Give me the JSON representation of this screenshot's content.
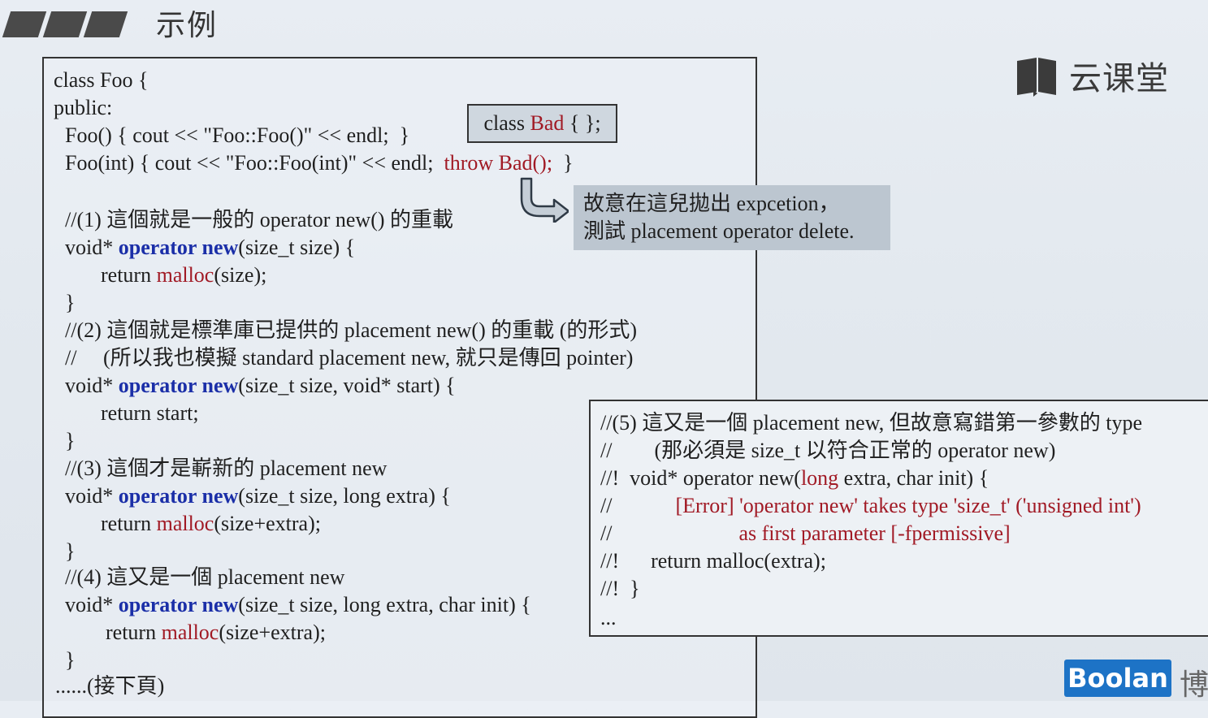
{
  "header": {
    "title": "示例"
  },
  "brand": {
    "name": "云课堂",
    "icon": "open-book-icon"
  },
  "code": {
    "l1": "class Foo {",
    "l2": "public:",
    "l3": "Foo() { cout << \"Foo::Foo()\" << endl;  }",
    "l4_pre": "Foo(int) { cout << \"Foo::Foo(int)\" << endl;  ",
    "l4_throw": "throw Bad();",
    "l4_post": "  }",
    "c1": "//(1) 這個就是一般的 operator new() 的重載",
    "op1_pre": "void* ",
    "op_kw": "operator new",
    "op1_post": "(size_t size) {",
    "ret1_pre": "return ",
    "malloc": "malloc",
    "ret1_post": "(size);",
    "close1": "}",
    "c2": "//(2) 這個就是標準庫已提供的 placement new() 的重載 (的形式)",
    "c2b": "//     (所以我也模擬 standard placement new, 就只是傳回 pointer)",
    "op2_pre": "void* ",
    "op2_post": "(size_t size, void* start) {",
    "ret2": "return start;",
    "close2": "}",
    "c3": "//(3) 這個才是嶄新的 placement new",
    "op3_pre": "void* ",
    "op3_post": "(size_t size, long extra) {",
    "ret3_pre": "return ",
    "ret3_post": "(size+extra);",
    "close3": "}",
    "c4": "//(4) 這又是一個 placement new",
    "op4_pre": "void* ",
    "op4_post": "(size_t size, long extra, char init) {",
    "ret4_pre": "return ",
    "ret4_post": "(size+extra);",
    "close4": "}",
    "more": "......(接下頁)"
  },
  "bad_class": {
    "pre": "class ",
    "name": "Bad",
    "post": " { };"
  },
  "note": {
    "line1": "故意在這兒拋出 expcetion，",
    "line2": "測試 placement operator delete."
  },
  "box5": {
    "l1": "//(5) 這又是一個 placement new, 但故意寫錯第一參數的 type",
    "l2": "//        (那必須是 size_t 以符合正常的 operator new)",
    "l3_pre": "//!  void* operator new(",
    "l3_long": "long",
    "l3_post": " extra, char init) {",
    "l4_pre": "//            ",
    "l4_err": "[Error] 'operator new' takes type 'size_t' ('unsigned int')",
    "l5_pre": "//                        ",
    "l5_err": "as first parameter [-fpermissive]",
    "l6": "//!      return malloc(extra);",
    "l7": "//!  }",
    "l8": "..."
  },
  "footer": {
    "logo": "Boolan",
    "logo_cn": "博"
  },
  "colors": {
    "keyword": "#1b2fa8",
    "highlight": "#a11a25",
    "logo_bg": "#1d73c6"
  }
}
